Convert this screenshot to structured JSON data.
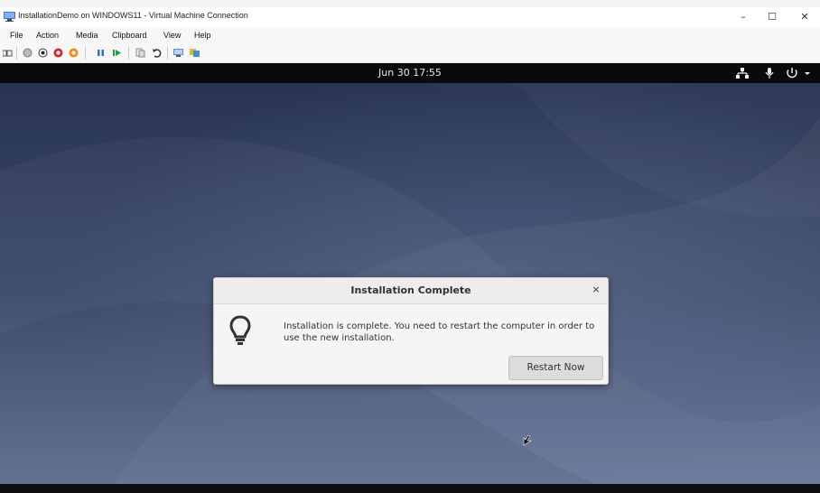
{
  "window": {
    "title": "InstallationDemo on WINDOWS11 - Virtual Machine Connection",
    "controls": {
      "minimize": "–",
      "maximize": "☐",
      "close": "✕"
    }
  },
  "menubar": {
    "items": [
      {
        "label": "File"
      },
      {
        "label": "Action"
      },
      {
        "label": "Media"
      },
      {
        "label": "Clipboard"
      },
      {
        "label": "View"
      },
      {
        "label": "Help"
      }
    ]
  },
  "toolbar": {
    "icons": [
      "ctrl-alt-del-icon",
      "start-icon",
      "turn-off-icon",
      "shut-down-icon",
      "save-icon",
      "pause-icon",
      "resume-icon",
      "checkpoint-icon",
      "revert-icon",
      "enhanced-session-icon",
      "share-icon"
    ]
  },
  "gnome": {
    "clock": "Jun 30  17:55",
    "status_icons": [
      "network-icon",
      "microphone-icon",
      "power-icon",
      "dropdown-arrow-icon"
    ]
  },
  "dialog": {
    "title": "Installation Complete",
    "close": "×",
    "message": "Installation is complete. You need to restart the computer in order to use the new installation.",
    "restart_button": "Restart Now"
  },
  "colors": {
    "desktop_top": "#283552",
    "desktop_bottom": "#5f7093",
    "gnome_bar": "#0a0a0a",
    "dialog_bg": "#f6f5f4"
  }
}
